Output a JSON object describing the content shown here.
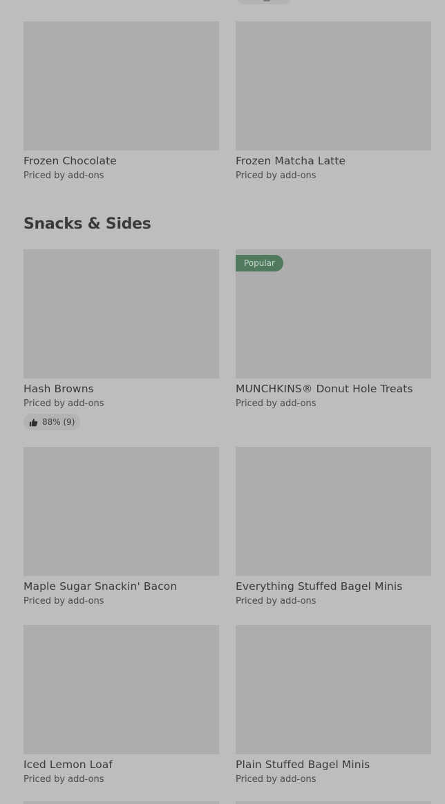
{
  "drinks_section": {
    "items": [
      {
        "name": "Frozen Chocolate",
        "price": "Priced by add-ons"
      },
      {
        "name": "Frozen Matcha Latte",
        "price": "Priced by add-ons"
      }
    ]
  },
  "snacks_section": {
    "title": "Snacks & Sides",
    "items": [
      {
        "name": "Hash Browns",
        "price": "Priced by add-ons",
        "rating": "88% (9)"
      },
      {
        "name": "MUNCHKINS® Donut Hole Treats",
        "price": "Priced by add-ons",
        "badge": "Popular"
      },
      {
        "name": "Maple Sugar Snackin' Bacon",
        "price": "Priced by add-ons"
      },
      {
        "name": "Everything Stuffed Bagel Minis",
        "price": "Priced by add-ons"
      },
      {
        "name": "Iced Lemon Loaf",
        "price": "Priced by add-ons"
      },
      {
        "name": "Plain Stuffed Bagel Minis",
        "price": "Priced by add-ons"
      }
    ]
  },
  "icons": {
    "rating_icon": "thumbs-up-icon"
  },
  "colors": {
    "popular_badge_bg": "#4f7a5e",
    "overlay_bg": "#bdbdbd"
  }
}
